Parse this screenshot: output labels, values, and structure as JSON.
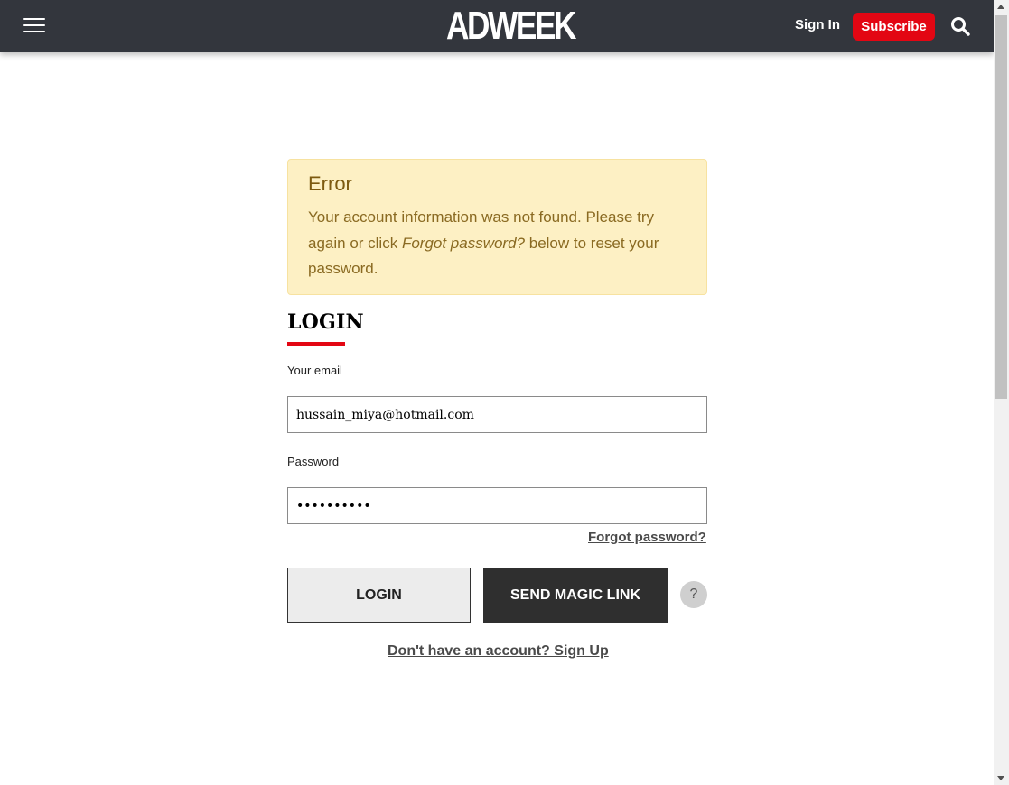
{
  "header": {
    "logo": "ADWEEK",
    "sign_in": "Sign In",
    "subscribe": "Subscribe",
    "menu_icon": "hamburger-icon",
    "search_icon": "search-icon",
    "bg_color": "#33363d",
    "accent_color": "#e30613"
  },
  "error": {
    "title": "Error",
    "message_before": "Your account information was not found. Please try again or click ",
    "message_link": "Forgot password?",
    "message_after": " below to reset your password."
  },
  "login": {
    "heading": "LOGIN",
    "email_label": "Your email",
    "email_value": "hussain_miya@hotmail.com",
    "password_label": "Password",
    "password_value": "••••••••••",
    "forgot_password": "Forgot password?",
    "login_button": "LOGIN",
    "magic_link_button": "SEND MAGIC LINK",
    "help": "?",
    "signup_link": "Don't have an account? Sign Up"
  }
}
